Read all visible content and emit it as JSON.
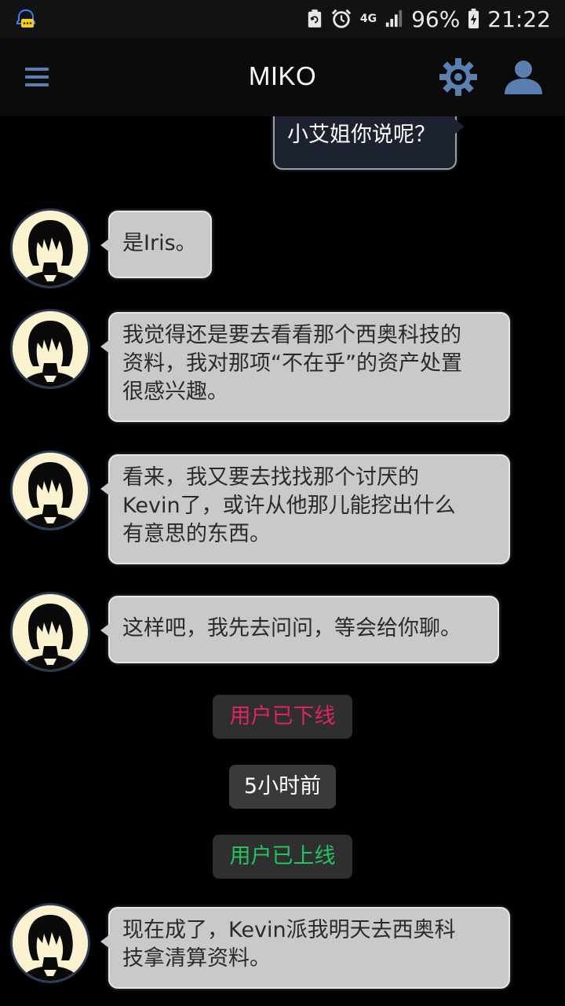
{
  "status_bar": {
    "battery_percent": "96%",
    "time": "21:22",
    "network": "4G",
    "icons": [
      "notification-app-icon",
      "sync-icon",
      "alarm-icon",
      "signal-icon",
      "battery-charging-icon"
    ]
  },
  "app_bar": {
    "title": "MIKO",
    "icons": [
      "menu-icon",
      "gear-icon",
      "user-icon"
    ],
    "icon_color": "#5a7fb0"
  },
  "messages": [
    {
      "sender": "me",
      "text": "小艾姐你说呢？"
    },
    {
      "sender": "miko",
      "lines": [
        "是Iris。"
      ]
    },
    {
      "sender": "miko",
      "lines": [
        "我觉得还是要去看看那个西奥科技的",
        "资料，我对那项“不在乎”的资产处置",
        "很感兴趣。"
      ]
    },
    {
      "sender": "miko",
      "lines": [
        "看来，我又要去找找那个讨厌的",
        "Kevin了，或许从他那儿能挖出什么",
        "有意思的东西。"
      ]
    },
    {
      "sender": "miko",
      "lines": [
        "这样吧，我先去问问，等会给你聊。"
      ]
    },
    {
      "sender": "miko",
      "lines": [
        "现在成了，Kevin派我明天去西奥科",
        "技拿清算资料。"
      ]
    }
  ],
  "system_notices": [
    {
      "text": "用户已下线",
      "color": "#e0245e"
    },
    {
      "text": "5小时前",
      "color": "#ffffff"
    },
    {
      "text": "用户已上线",
      "color": "#22c55e"
    }
  ],
  "colors": {
    "background": "#000000",
    "incoming_bubble": "#c9c9c9",
    "outgoing_bubble": "#1c2230"
  }
}
